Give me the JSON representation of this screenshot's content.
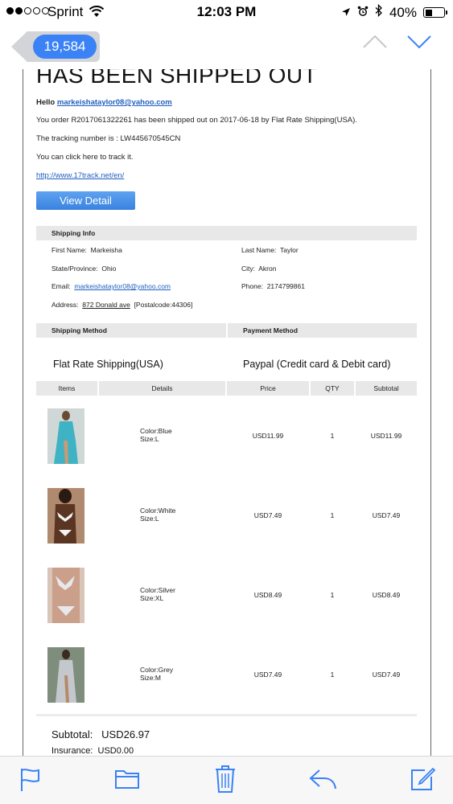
{
  "status_bar": {
    "carrier": "Sprint",
    "time": "12:03 PM",
    "battery": "40%",
    "battery_level": 0.4,
    "signal_bars_filled": 2,
    "signal_bars_total": 5
  },
  "nav": {
    "unread_count": "19,584",
    "accent_color": "#3a82f6"
  },
  "email": {
    "headline": "HAS BEEN SHIPPED OUT",
    "greeting": "Hello",
    "email_address": "markeishataylor08@yahoo.com",
    "line_shipped": "You order R2017061322261 has been shipped out on 2017-06-18 by Flat Rate Shipping(USA).",
    "line_tracking": "The tracking number is : LW445670545CN",
    "line_track_here": "You can click here to track it.",
    "track_url": "http://www.17track.net/en/",
    "view_detail_label": "View Detail",
    "shipping_info": {
      "title": "Shipping Info",
      "first_name_label": "First Name:",
      "first_name": "Markeisha",
      "last_name_label": "Last Name:",
      "last_name": "Taylor",
      "state_label": "State/Province:",
      "state": "Ohio",
      "city_label": "City:",
      "city": "Akron",
      "email_label": "Email:",
      "email": "markeishataylor08@yahoo.com",
      "phone_label": "Phone:",
      "phone": "2174799861",
      "address_label": "Address:",
      "address": "872 Donald ave",
      "postal": "[Postalcode:44306]"
    },
    "shipping_method_title": "Shipping Method",
    "payment_method_title": "Payment Method",
    "shipping_method": "Flat Rate Shipping(USA)",
    "payment_method": "Paypal (Credit card & Debit card)",
    "table_headers": [
      "Items",
      "Details",
      "Price",
      "QTY",
      "Subtotal"
    ],
    "items": [
      {
        "color": "Color:Blue",
        "size": "Size:L",
        "price": "USD11.99",
        "qty": "1",
        "subtotal": "USD11.99"
      },
      {
        "color": "Color:White",
        "size": "Size:L",
        "price": "USD7.49",
        "qty": "1",
        "subtotal": "USD7.49"
      },
      {
        "color": "Color:Silver",
        "size": "Size:XL",
        "price": "USD8.49",
        "qty": "1",
        "subtotal": "USD8.49"
      },
      {
        "color": "Color:Grey",
        "size": "Size:M",
        "price": "USD7.49",
        "qty": "1",
        "subtotal": "USD7.49"
      }
    ],
    "subtotal_label": "Subtotal:",
    "subtotal_value": "USD26.97",
    "insurance_label": "Insurance:",
    "insurance_value": "USD0.00"
  },
  "toolbar": {
    "icons": [
      "flag-icon",
      "folder-icon",
      "trash-icon",
      "reply-icon",
      "compose-icon"
    ],
    "icon_color": "#3a82f6"
  }
}
